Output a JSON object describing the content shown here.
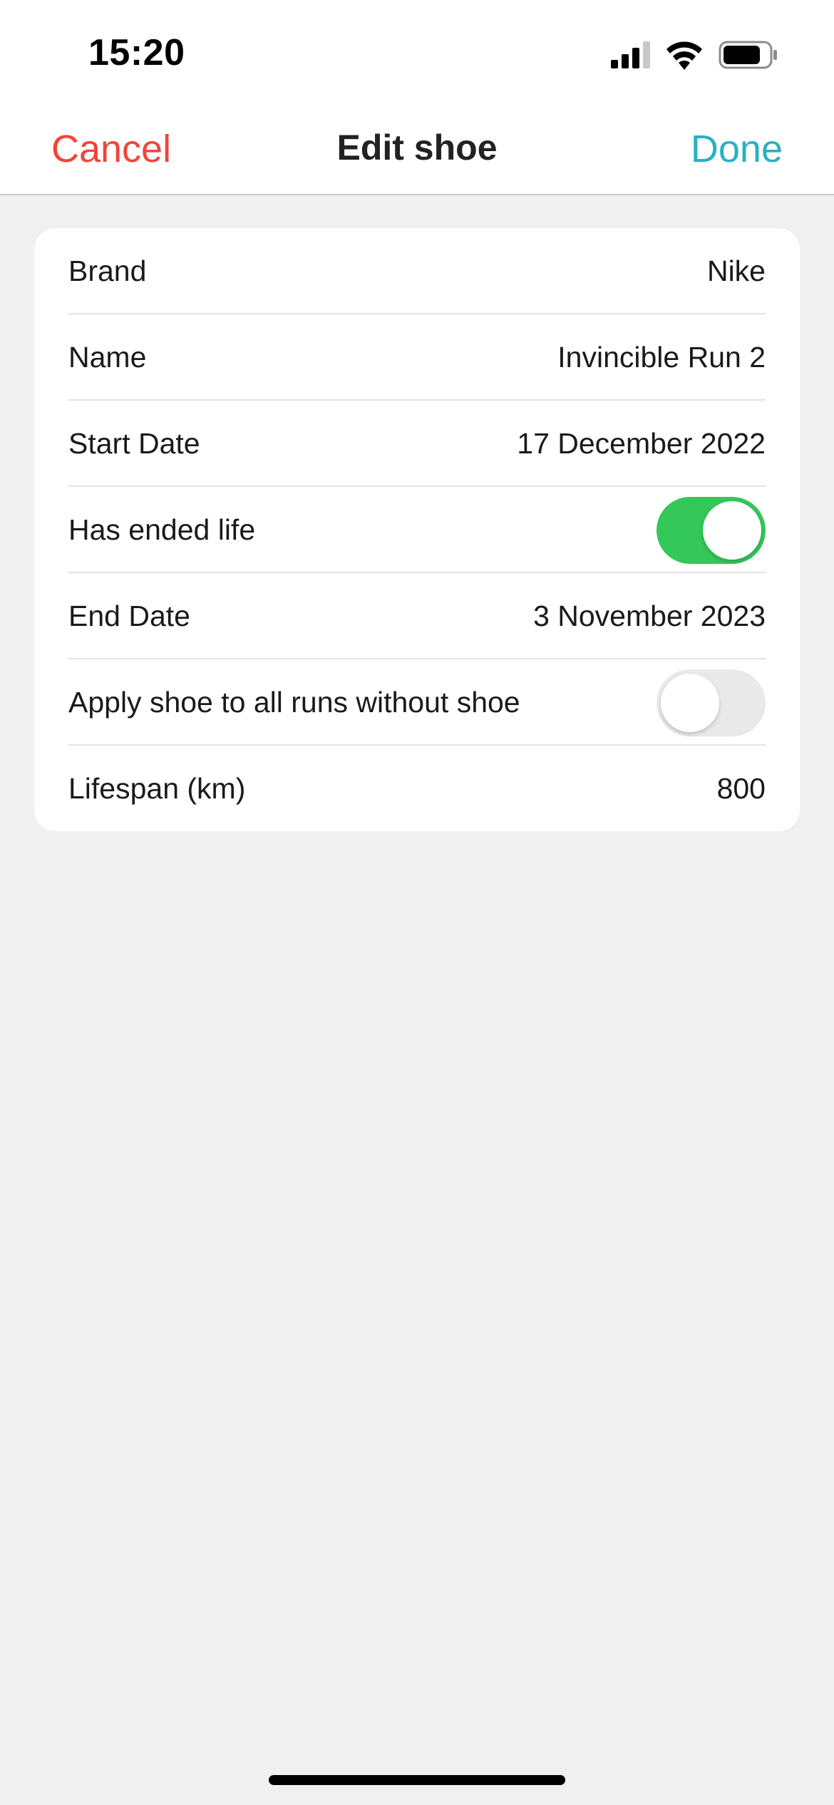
{
  "status_bar": {
    "time": "15:20",
    "icons": [
      "signal-icon",
      "wifi-icon",
      "battery-icon"
    ]
  },
  "nav": {
    "cancel_label": "Cancel",
    "title": "Edit shoe",
    "done_label": "Done"
  },
  "form": {
    "brand": {
      "label": "Brand",
      "value": "Nike"
    },
    "name": {
      "label": "Name",
      "value": "Invincible Run 2"
    },
    "start_date": {
      "label": "Start Date",
      "value": "17 December 2022"
    },
    "has_ended_life": {
      "label": "Has ended life",
      "on": true
    },
    "end_date": {
      "label": "End Date",
      "value": "3 November 2023"
    },
    "apply_to_all": {
      "label": "Apply shoe to all runs without shoe",
      "on": false
    },
    "lifespan": {
      "label": "Lifespan (km)",
      "value": "800"
    }
  },
  "colors": {
    "cancel": "#f04438",
    "done": "#2ab0c4",
    "toggle_on": "#34c759",
    "toggle_off": "#e9e9ea",
    "background": "#f0f0f0"
  }
}
